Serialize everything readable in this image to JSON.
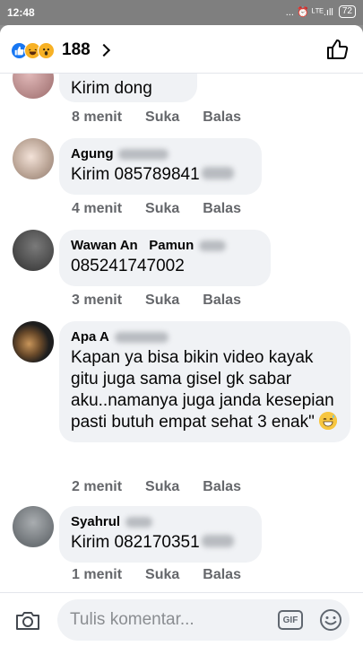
{
  "status_bar": {
    "time": "12:48",
    "indicators": "... ⏰ ᴸᵀᴱ.ıll",
    "battery": "72"
  },
  "header": {
    "reactions": [
      "like-icon",
      "haha-icon",
      "wow-icon"
    ],
    "count": "188",
    "like_icon": "thumbs-up-outline-icon"
  },
  "comments": [
    {
      "name": "",
      "text": "Kirim dong",
      "time": "8 menit",
      "like": "Suka",
      "reply": "Balas",
      "avatar_color": "#b07a7a"
    },
    {
      "name": "Agung",
      "text": "Kirim 085789841",
      "time": "4 menit",
      "like": "Suka",
      "reply": "Balas",
      "avatar_color": "#c8b4a6"
    },
    {
      "name": "Wawan An   Pamun",
      "text": "085241747002",
      "time": "3 menit",
      "like": "Suka",
      "reply": "Balas",
      "avatar_color": "#6b6b6b"
    },
    {
      "name": "Apa A",
      "text": "Kapan ya bisa bikin video kayak gitu juga sama gisel gk sabar aku..namanya juga janda kesepian pasti butuh empat sehat 3 enak\"",
      "time": "2 menit",
      "like": "Suka",
      "reply": "Balas",
      "avatar_color": "#3a3a3a"
    },
    {
      "name": "Syahrul",
      "text": "Kirim 082170351",
      "time": "1 menit",
      "like": "Suka",
      "reply": "Balas",
      "avatar_color": "#8a8f93"
    }
  ],
  "composer": {
    "placeholder": "Tulis komentar...",
    "gif_label": "GIF"
  }
}
